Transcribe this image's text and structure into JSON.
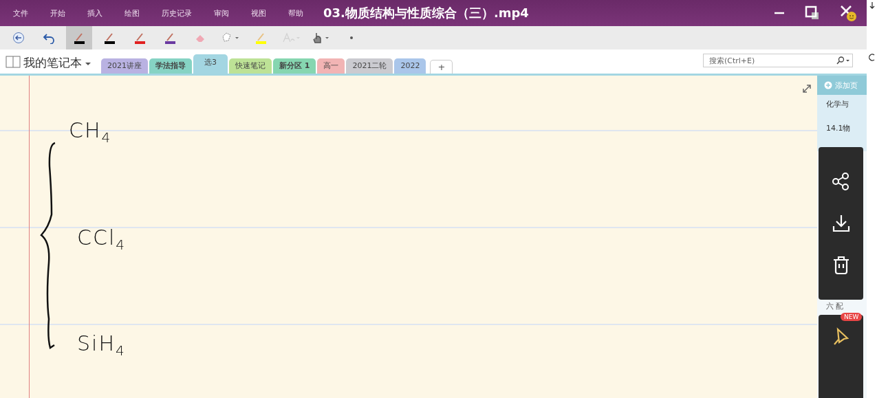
{
  "window": {
    "title": "03.物质结构与性质综合（三）.mp4",
    "menus": [
      "文件",
      "开始",
      "插入",
      "绘图",
      "历史记录",
      "审阅",
      "视图",
      "帮助"
    ]
  },
  "toolbar": [
    {
      "kind": "back",
      "selected": false
    },
    {
      "kind": "undo",
      "selected": false
    },
    {
      "kind": "pen",
      "color": "#000000",
      "selected": true
    },
    {
      "kind": "pen",
      "color": "#000000",
      "selected": false
    },
    {
      "kind": "pen",
      "color": "#e02020",
      "selected": false
    },
    {
      "kind": "pen",
      "color": "#6a3aa0",
      "selected": false
    },
    {
      "kind": "eraser",
      "selected": false
    },
    {
      "kind": "lasso",
      "selected": false
    },
    {
      "kind": "highlighter",
      "color": "#ffff00",
      "selected": false
    },
    {
      "kind": "ink-to-text",
      "selected": false
    },
    {
      "kind": "touch",
      "selected": false
    },
    {
      "kind": "more",
      "selected": false
    }
  ],
  "notebook": {
    "name": "我的笔记本"
  },
  "sections": [
    {
      "label": "2021讲座",
      "color": "#b9b2e2",
      "selected": false,
      "bold": false
    },
    {
      "label": "学法指导",
      "color": "#86d3c4",
      "selected": false,
      "bold": true
    },
    {
      "label": "选3",
      "color": "#a3d6e2",
      "selected": true,
      "bold": false
    },
    {
      "label": "快速笔记",
      "color": "#bde296",
      "selected": false,
      "bold": false
    },
    {
      "label": "新分区 1",
      "color": "#86d6b0",
      "selected": false,
      "bold": true
    },
    {
      "label": "高一",
      "color": "#f2b4b4",
      "selected": false,
      "bold": false
    },
    {
      "label": "2021二轮",
      "color": "#cbcbd0",
      "selected": false,
      "bold": false
    },
    {
      "label": "2022",
      "color": "#aac6ea",
      "selected": false,
      "bold": false
    }
  ],
  "add_section": "+",
  "search": {
    "placeholder": "搜索(Ctrl+E)"
  },
  "page": {
    "ink": [
      {
        "text": "CH$_{4}$"
      },
      {
        "text": "CCl$_{4}$"
      },
      {
        "text": "SiH$_{4}$"
      }
    ]
  },
  "page_list": {
    "add_label": "添加页",
    "items": [
      {
        "label": "化学与"
      },
      {
        "label": "14.1物"
      }
    ],
    "below": "六 配"
  },
  "overlay": {
    "badge": "NEW"
  }
}
